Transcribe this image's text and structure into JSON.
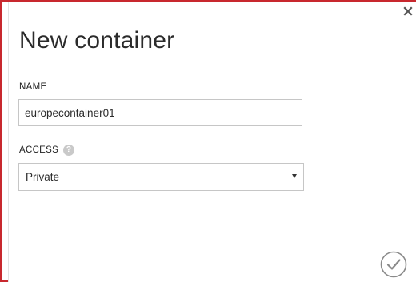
{
  "dialog": {
    "title": "New container",
    "close_icon": "close-icon",
    "confirm_icon": "checkmark-icon"
  },
  "fields": {
    "name": {
      "label": "NAME",
      "value": "europecontainer01"
    },
    "access": {
      "label": "ACCESS",
      "help_icon": "question-mark-icon",
      "help_glyph": "?",
      "selected": "Private"
    }
  },
  "colors": {
    "frame_border": "#c8282e",
    "text": "#2b2b2b",
    "input_border": "#c6c6c6",
    "help_icon_bg": "#c9c9c9",
    "confirm_icon": "#8a8a8a"
  }
}
